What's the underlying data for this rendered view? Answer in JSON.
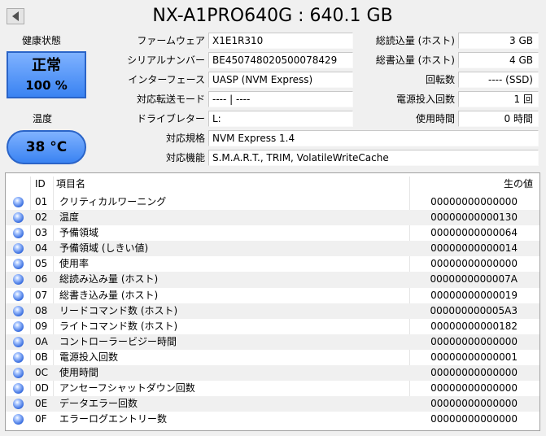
{
  "title": "NX-A1PRO640G : 640.1 GB",
  "health": {
    "label": "健康状態",
    "status": "正常",
    "percent": "100 %"
  },
  "temperature": {
    "label": "温度",
    "value": "38 °C"
  },
  "info": {
    "firmware": {
      "label": "ファームウェア",
      "value": "X1E1R310"
    },
    "serial": {
      "label": "シリアルナンバー",
      "value": "BE450748020500078429"
    },
    "interface": {
      "label": "インターフェース",
      "value": "UASP (NVM Express)"
    },
    "transfer_mode": {
      "label": "対応転送モード",
      "value": "---- | ----"
    },
    "drive_letter": {
      "label": "ドライブレター",
      "value": "L:"
    },
    "standard": {
      "label": "対応規格",
      "value": "NVM Express 1.4"
    },
    "features": {
      "label": "対応機能",
      "value": "S.M.A.R.T., TRIM, VolatileWriteCache"
    }
  },
  "stats": {
    "host_reads": {
      "label": "総読込量 (ホスト)",
      "value": "3 GB"
    },
    "host_writes": {
      "label": "総書込量 (ホスト)",
      "value": "4 GB"
    },
    "rotation": {
      "label": "回転数",
      "value": "---- (SSD)"
    },
    "power_on_count": {
      "label": "電源投入回数",
      "value": "1 回"
    },
    "power_on_hours": {
      "label": "使用時間",
      "value": "0 時間"
    }
  },
  "table": {
    "headers": {
      "id": "ID",
      "name": "項目名",
      "raw": "生の値"
    },
    "rows": [
      {
        "id": "01",
        "name": "クリティカルワーニング",
        "raw": "00000000000000"
      },
      {
        "id": "02",
        "name": "温度",
        "raw": "00000000000130"
      },
      {
        "id": "03",
        "name": "予備領域",
        "raw": "00000000000064"
      },
      {
        "id": "04",
        "name": "予備領域 (しきい値)",
        "raw": "00000000000014"
      },
      {
        "id": "05",
        "name": "使用率",
        "raw": "00000000000000"
      },
      {
        "id": "06",
        "name": "総読み込み量 (ホスト)",
        "raw": "0000000000007A"
      },
      {
        "id": "07",
        "name": "総書き込み量 (ホスト)",
        "raw": "00000000000019"
      },
      {
        "id": "08",
        "name": "リードコマンド数 (ホスト)",
        "raw": "000000000005A3"
      },
      {
        "id": "09",
        "name": "ライトコマンド数 (ホスト)",
        "raw": "00000000000182"
      },
      {
        "id": "0A",
        "name": "コントローラービジー時間",
        "raw": "00000000000000"
      },
      {
        "id": "0B",
        "name": "電源投入回数",
        "raw": "00000000000001"
      },
      {
        "id": "0C",
        "name": "使用時間",
        "raw": "00000000000000"
      },
      {
        "id": "0D",
        "name": "アンセーフシャットダウン回数",
        "raw": "00000000000000"
      },
      {
        "id": "0E",
        "name": "データエラー回数",
        "raw": "00000000000000"
      },
      {
        "id": "0F",
        "name": "エラーログエントリー数",
        "raw": "00000000000000"
      }
    ]
  }
}
